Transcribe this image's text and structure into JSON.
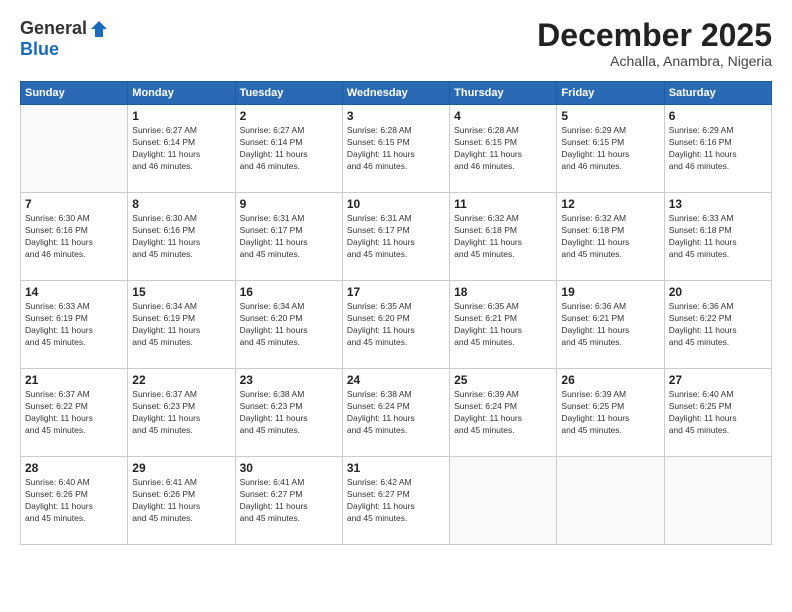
{
  "header": {
    "logo_general": "General",
    "logo_blue": "Blue",
    "month": "December 2025",
    "location": "Achalla, Anambra, Nigeria"
  },
  "weekdays": [
    "Sunday",
    "Monday",
    "Tuesday",
    "Wednesday",
    "Thursday",
    "Friday",
    "Saturday"
  ],
  "weeks": [
    [
      {
        "day": "",
        "info": ""
      },
      {
        "day": "1",
        "info": "Sunrise: 6:27 AM\nSunset: 6:14 PM\nDaylight: 11 hours\nand 46 minutes."
      },
      {
        "day": "2",
        "info": "Sunrise: 6:27 AM\nSunset: 6:14 PM\nDaylight: 11 hours\nand 46 minutes."
      },
      {
        "day": "3",
        "info": "Sunrise: 6:28 AM\nSunset: 6:15 PM\nDaylight: 11 hours\nand 46 minutes."
      },
      {
        "day": "4",
        "info": "Sunrise: 6:28 AM\nSunset: 6:15 PM\nDaylight: 11 hours\nand 46 minutes."
      },
      {
        "day": "5",
        "info": "Sunrise: 6:29 AM\nSunset: 6:15 PM\nDaylight: 11 hours\nand 46 minutes."
      },
      {
        "day": "6",
        "info": "Sunrise: 6:29 AM\nSunset: 6:16 PM\nDaylight: 11 hours\nand 46 minutes."
      }
    ],
    [
      {
        "day": "7",
        "info": "Sunrise: 6:30 AM\nSunset: 6:16 PM\nDaylight: 11 hours\nand 46 minutes."
      },
      {
        "day": "8",
        "info": "Sunrise: 6:30 AM\nSunset: 6:16 PM\nDaylight: 11 hours\nand 45 minutes."
      },
      {
        "day": "9",
        "info": "Sunrise: 6:31 AM\nSunset: 6:17 PM\nDaylight: 11 hours\nand 45 minutes."
      },
      {
        "day": "10",
        "info": "Sunrise: 6:31 AM\nSunset: 6:17 PM\nDaylight: 11 hours\nand 45 minutes."
      },
      {
        "day": "11",
        "info": "Sunrise: 6:32 AM\nSunset: 6:18 PM\nDaylight: 11 hours\nand 45 minutes."
      },
      {
        "day": "12",
        "info": "Sunrise: 6:32 AM\nSunset: 6:18 PM\nDaylight: 11 hours\nand 45 minutes."
      },
      {
        "day": "13",
        "info": "Sunrise: 6:33 AM\nSunset: 6:18 PM\nDaylight: 11 hours\nand 45 minutes."
      }
    ],
    [
      {
        "day": "14",
        "info": "Sunrise: 6:33 AM\nSunset: 6:19 PM\nDaylight: 11 hours\nand 45 minutes."
      },
      {
        "day": "15",
        "info": "Sunrise: 6:34 AM\nSunset: 6:19 PM\nDaylight: 11 hours\nand 45 minutes."
      },
      {
        "day": "16",
        "info": "Sunrise: 6:34 AM\nSunset: 6:20 PM\nDaylight: 11 hours\nand 45 minutes."
      },
      {
        "day": "17",
        "info": "Sunrise: 6:35 AM\nSunset: 6:20 PM\nDaylight: 11 hours\nand 45 minutes."
      },
      {
        "day": "18",
        "info": "Sunrise: 6:35 AM\nSunset: 6:21 PM\nDaylight: 11 hours\nand 45 minutes."
      },
      {
        "day": "19",
        "info": "Sunrise: 6:36 AM\nSunset: 6:21 PM\nDaylight: 11 hours\nand 45 minutes."
      },
      {
        "day": "20",
        "info": "Sunrise: 6:36 AM\nSunset: 6:22 PM\nDaylight: 11 hours\nand 45 minutes."
      }
    ],
    [
      {
        "day": "21",
        "info": "Sunrise: 6:37 AM\nSunset: 6:22 PM\nDaylight: 11 hours\nand 45 minutes."
      },
      {
        "day": "22",
        "info": "Sunrise: 6:37 AM\nSunset: 6:23 PM\nDaylight: 11 hours\nand 45 minutes."
      },
      {
        "day": "23",
        "info": "Sunrise: 6:38 AM\nSunset: 6:23 PM\nDaylight: 11 hours\nand 45 minutes."
      },
      {
        "day": "24",
        "info": "Sunrise: 6:38 AM\nSunset: 6:24 PM\nDaylight: 11 hours\nand 45 minutes."
      },
      {
        "day": "25",
        "info": "Sunrise: 6:39 AM\nSunset: 6:24 PM\nDaylight: 11 hours\nand 45 minutes."
      },
      {
        "day": "26",
        "info": "Sunrise: 6:39 AM\nSunset: 6:25 PM\nDaylight: 11 hours\nand 45 minutes."
      },
      {
        "day": "27",
        "info": "Sunrise: 6:40 AM\nSunset: 6:25 PM\nDaylight: 11 hours\nand 45 minutes."
      }
    ],
    [
      {
        "day": "28",
        "info": "Sunrise: 6:40 AM\nSunset: 6:26 PM\nDaylight: 11 hours\nand 45 minutes."
      },
      {
        "day": "29",
        "info": "Sunrise: 6:41 AM\nSunset: 6:26 PM\nDaylight: 11 hours\nand 45 minutes."
      },
      {
        "day": "30",
        "info": "Sunrise: 6:41 AM\nSunset: 6:27 PM\nDaylight: 11 hours\nand 45 minutes."
      },
      {
        "day": "31",
        "info": "Sunrise: 6:42 AM\nSunset: 6:27 PM\nDaylight: 11 hours\nand 45 minutes."
      },
      {
        "day": "",
        "info": ""
      },
      {
        "day": "",
        "info": ""
      },
      {
        "day": "",
        "info": ""
      }
    ]
  ]
}
